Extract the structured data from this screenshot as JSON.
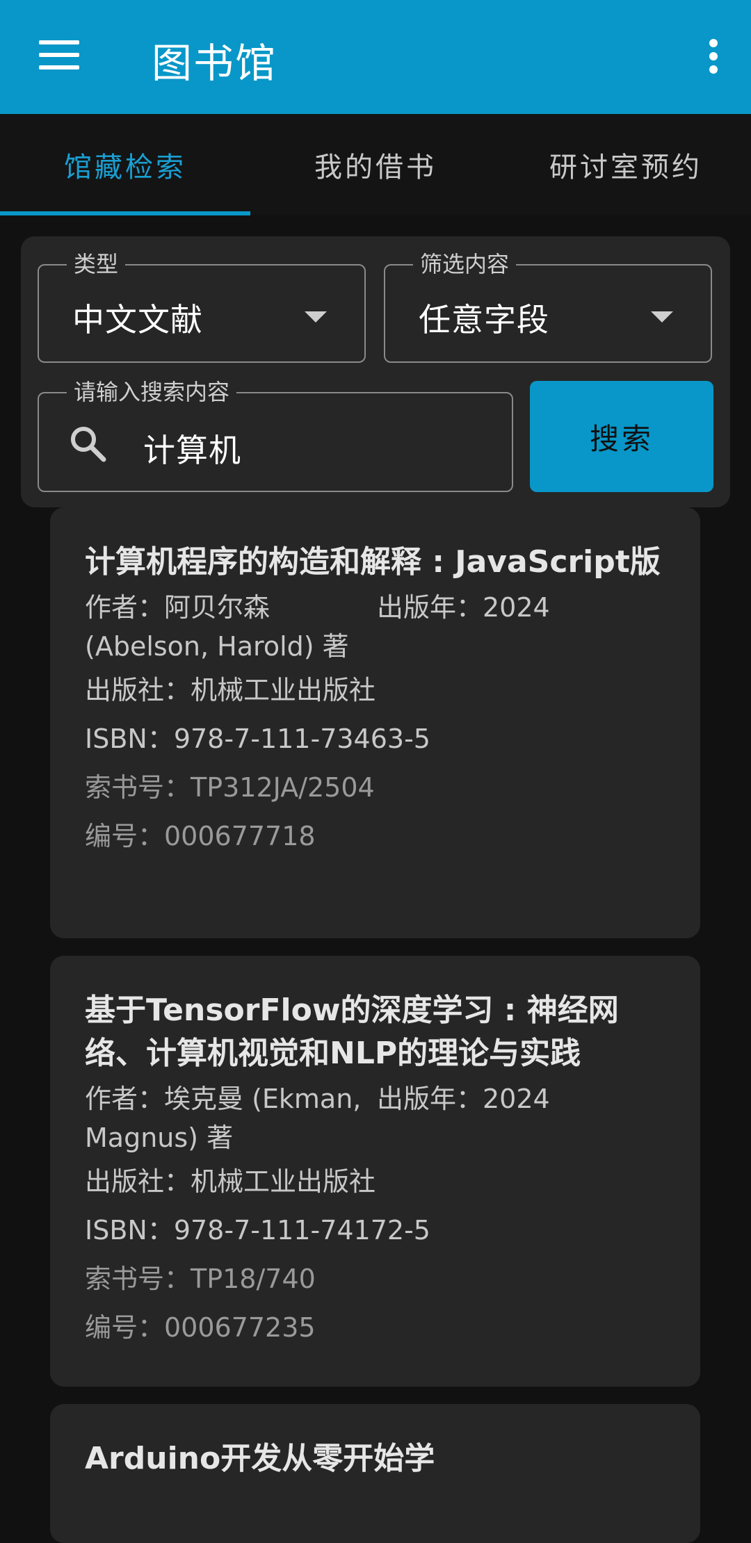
{
  "app": {
    "title": "图书馆"
  },
  "tabs": [
    {
      "label": "馆藏检索",
      "active": true
    },
    {
      "label": "我的借书",
      "active": false
    },
    {
      "label": "研讨室预约",
      "active": false
    }
  ],
  "search": {
    "type_label": "类型",
    "type_value": "中文文献",
    "filter_label": "筛选内容",
    "filter_value": "任意字段",
    "query_label": "请输入搜索内容",
    "query_value": "计算机",
    "button_label": "搜索"
  },
  "results": [
    {
      "title": "计算机程序的构造和解释 : JavaScript版",
      "author": "作者：阿贝尔森 (Abelson, Harold) 著",
      "year": "出版年：2024",
      "publisher": "出版社：机械工业出版社",
      "isbn": "ISBN：978-7-111-73463-5",
      "call_number": "索书号：TP312JA/2504",
      "id": "编号：000677718"
    },
    {
      "title": "基于TensorFlow的深度学习 : 神经网络、计算机视觉和NLP的理论与实践",
      "author": "作者：埃克曼 (Ekman, Magnus) 著",
      "year": "出版年：2024",
      "publisher": "出版社：机械工业出版社",
      "isbn": "ISBN：978-7-111-74172-5",
      "call_number": "索书号：TP18/740",
      "id": "编号：000677235"
    },
    {
      "title": "Arduino开发从零开始学"
    }
  ],
  "colors": {
    "accent": "#0897c8",
    "background": "#111111",
    "card": "#262626"
  },
  "icons": [
    "menu-icon",
    "more-vert-icon",
    "search-icon",
    "dropdown-arrow-icon"
  ]
}
